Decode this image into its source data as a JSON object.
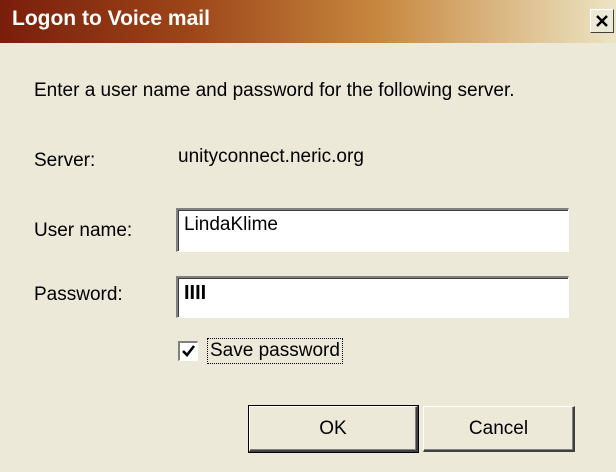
{
  "window": {
    "title": "Logon to Voice mail",
    "close_icon": "close-icon"
  },
  "dialog": {
    "instruction": "Enter a user name and password for the following server.",
    "server_label": "Server:",
    "server_value": "unityconnect.neric.org",
    "username_label": "User name:",
    "username_value": "LindaKlime",
    "password_label": "Password:",
    "password_mask": "IIII",
    "save_password_label": "Save password",
    "save_password_checked": true,
    "ok_label": "OK",
    "cancel_label": "Cancel"
  }
}
